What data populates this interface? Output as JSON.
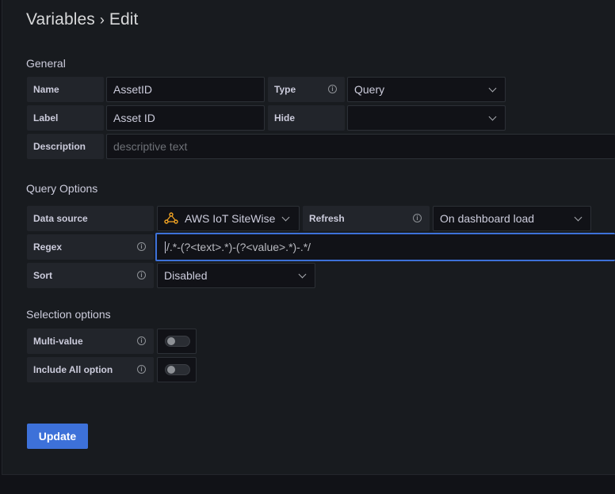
{
  "header": {
    "title": "Variables",
    "separator": "›",
    "subtitle": "Edit"
  },
  "general": {
    "heading": "General",
    "name_label": "Name",
    "name_value": "AssetID",
    "type_label": "Type",
    "type_value": "Query",
    "label_label": "Label",
    "label_value": "Asset ID",
    "hide_label": "Hide",
    "hide_value": "",
    "description_label": "Description",
    "description_placeholder": "descriptive text"
  },
  "query_options": {
    "heading": "Query Options",
    "datasource_label": "Data source",
    "datasource_value": "AWS IoT SiteWise",
    "refresh_label": "Refresh",
    "refresh_value": "On dashboard load",
    "regex_label": "Regex",
    "regex_value": "/.*-(?<text>.*)-(?<value>.*)-.*/",
    "sort_label": "Sort",
    "sort_value": "Disabled"
  },
  "selection_options": {
    "heading": "Selection options",
    "multi_value_label": "Multi-value",
    "multi_value_enabled": false,
    "include_all_label": "Include All option",
    "include_all_enabled": false
  },
  "actions": {
    "update_label": "Update"
  },
  "colors": {
    "accent": "#3d71d9",
    "sitewise_icon": "#f5a623"
  }
}
